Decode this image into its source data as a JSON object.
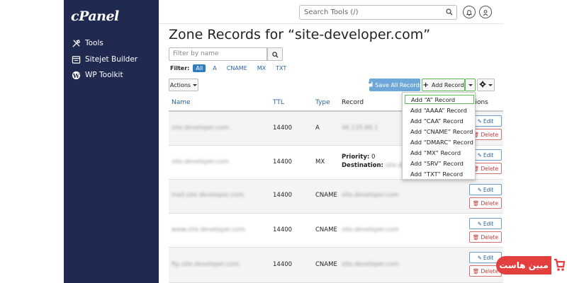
{
  "app": {
    "logo": "cPanel"
  },
  "sidebar": {
    "items": [
      {
        "label": "Tools",
        "icon": "tools-icon"
      },
      {
        "label": "Sitejet Builder",
        "icon": "sitejet-icon"
      },
      {
        "label": "WP Toolkit",
        "icon": "wordpress-icon"
      }
    ]
  },
  "header": {
    "search_placeholder": "Search Tools (/)"
  },
  "page": {
    "title": "Zone Records for “site-developer.com”"
  },
  "filter": {
    "placeholder": "Filter by name",
    "label": "Filter:",
    "chips": [
      "All",
      "A",
      "CNAME",
      "MX",
      "TXT"
    ],
    "active": "All"
  },
  "toolbar": {
    "actions_label": "Actions",
    "save_label": "Save All Records",
    "add_label": "Add Record"
  },
  "table": {
    "headers": {
      "name": "Name",
      "ttl": "TTL",
      "type": "Type",
      "record": "Record",
      "actions": "Actions"
    },
    "rows": [
      {
        "name": "site.developer.com.",
        "ttl": "14400",
        "type": "A",
        "record": "46.135.88.1"
      },
      {
        "name": "site.developer.com.",
        "ttl": "14400",
        "type": "MX",
        "priority_label": "Priority:",
        "priority": "0",
        "destination_label": "Destination:",
        "destination": "site.developer.com"
      },
      {
        "name": "mail.site.developer.com.",
        "ttl": "14400",
        "type": "CNAME",
        "record": "site.developer.com"
      },
      {
        "name": "www.site.developer.com.",
        "ttl": "14400",
        "type": "CNAME",
        "record": "site.developer.com"
      },
      {
        "name": "ftp.site.developer.com.",
        "ttl": "14400",
        "type": "CNAME",
        "record": "site.developer.com"
      }
    ],
    "edit_label": "Edit",
    "delete_label": "Delete"
  },
  "dropdown": {
    "items": [
      "Add “A” Record",
      "Add “AAAA” Record",
      "Add “CAA” Record",
      "Add “CNAME” Record",
      "Add “DMARC” Record",
      "Add “MX” Record",
      "Add “SRV” Record",
      "Add “TXT” Record"
    ]
  },
  "watermark": {
    "text": "مبین هاست"
  },
  "colors": {
    "sidebar": "#20294f",
    "primary": "#2f7cc1",
    "save": "#6ea8d8",
    "highlight": "#5fba59",
    "danger": "#c53a3a",
    "watermark": "#e43f3f"
  }
}
